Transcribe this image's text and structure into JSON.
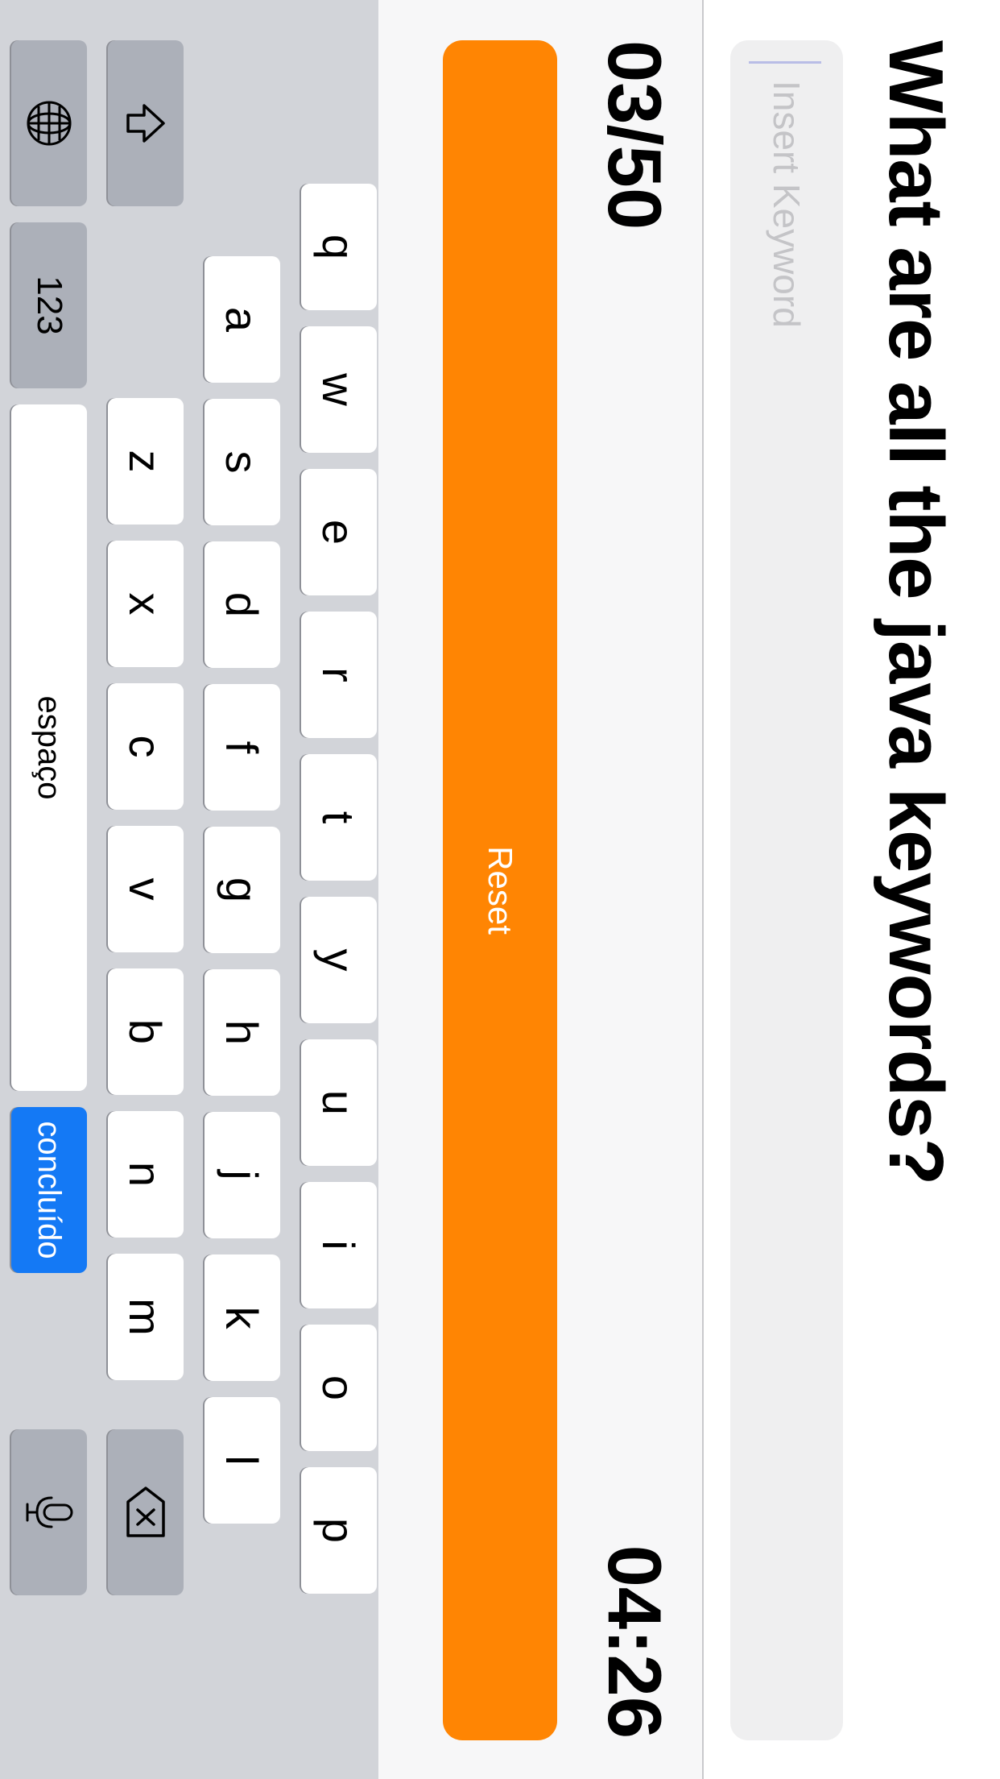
{
  "quiz": {
    "title": "What are all the java keywords?",
    "input_placeholder": "Insert Keyword",
    "input_value": "",
    "counter": "03/50",
    "timer": "04:26",
    "reset_label": "Reset"
  },
  "keyboard": {
    "row1": [
      "q",
      "w",
      "e",
      "r",
      "t",
      "y",
      "u",
      "i",
      "o",
      "p"
    ],
    "row2": [
      "a",
      "s",
      "d",
      "f",
      "g",
      "h",
      "j",
      "k",
      "l"
    ],
    "row3": [
      "z",
      "x",
      "c",
      "v",
      "b",
      "n",
      "m"
    ],
    "numbers_label": "123",
    "space_label": "espaço",
    "done_label": "concluído",
    "icons": {
      "shift": "shift-icon",
      "backspace": "backspace-icon",
      "globe": "globe-icon",
      "microphone": "microphone-icon"
    }
  }
}
